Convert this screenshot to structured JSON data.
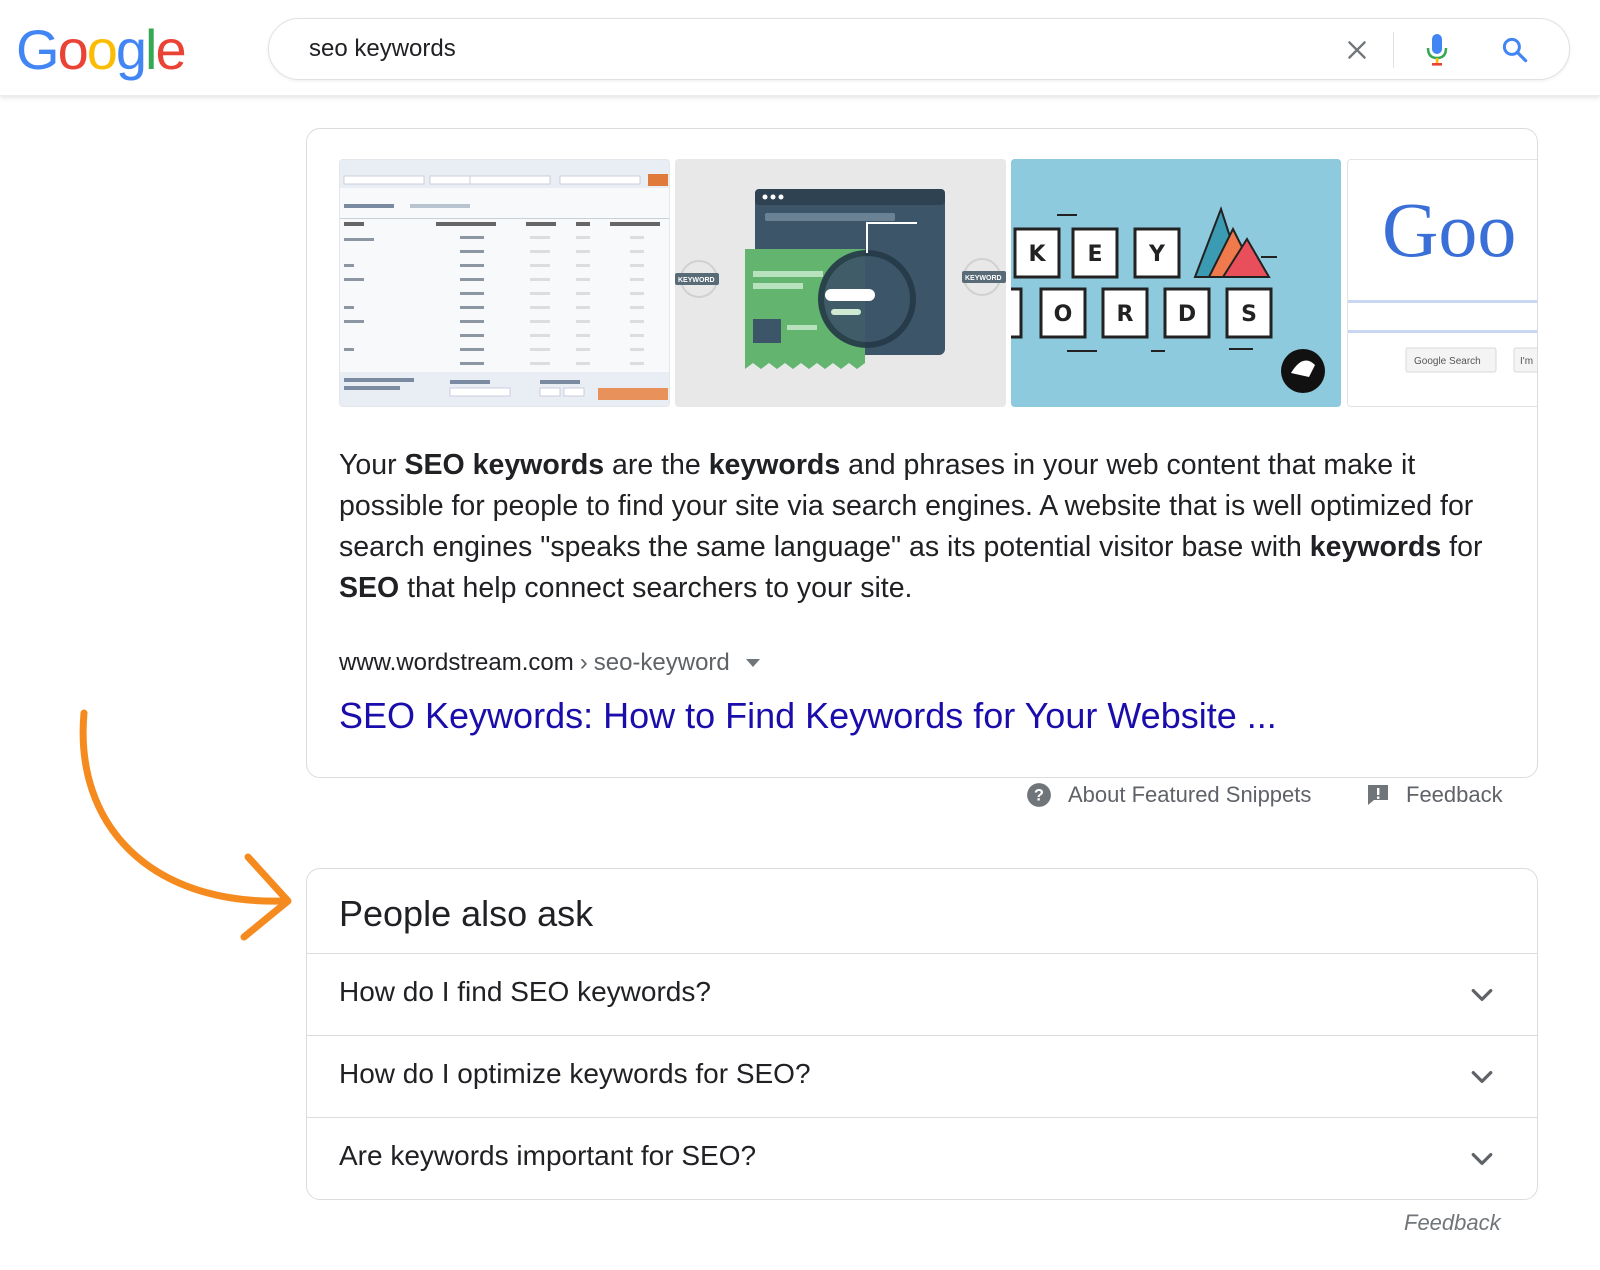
{
  "header": {
    "logo_letters": [
      "G",
      "o",
      "o",
      "g",
      "l",
      "e"
    ],
    "search_query": "seo keywords"
  },
  "snippet": {
    "text_parts": [
      {
        "t": "Your ",
        "b": false
      },
      {
        "t": "SEO keywords",
        "b": true
      },
      {
        "t": " are the ",
        "b": false
      },
      {
        "t": "keywords",
        "b": true
      },
      {
        "t": " and phrases in your web content that make it possible for people to find your site via search engines. A website that is well optimized for search engines \"speaks the same language\" as its potential visitor base with ",
        "b": false
      },
      {
        "t": "keywords",
        "b": true
      },
      {
        "t": " for ",
        "b": false
      },
      {
        "t": "SEO",
        "b": true
      },
      {
        "t": " that help connect searchers to your site.",
        "b": false
      }
    ],
    "cite_domain": "www.wordstream.com",
    "cite_separator": "›",
    "cite_path": "seo-keyword",
    "title": "SEO Keywords: How to Find Keywords for Your Website ...",
    "thumb2_labels": [
      "KEYWORD",
      "KEYWORD"
    ],
    "thumb3_tiles_row1": [
      "K",
      "E",
      "Y"
    ],
    "thumb3_tiles_row2": [
      "O",
      "R",
      "D",
      "S"
    ],
    "thumb4_logo": "Goo",
    "thumb4_buttons": [
      "Google Search",
      "I'm"
    ]
  },
  "below_snippet": {
    "about_label": "About Featured Snippets",
    "feedback_label": "Feedback"
  },
  "paa": {
    "title": "People also ask",
    "questions": [
      "How do I find SEO keywords?",
      "How do I optimize keywords for SEO?",
      "Are keywords important for SEO?"
    ],
    "feedback_label": "Feedback"
  },
  "colors": {
    "link_blue": "#1a0dab",
    "accent_orange": "#f58a1f",
    "google_blue": "#4285f4",
    "google_red": "#ea4335",
    "google_yellow": "#fbbc05",
    "google_green": "#34a853"
  }
}
